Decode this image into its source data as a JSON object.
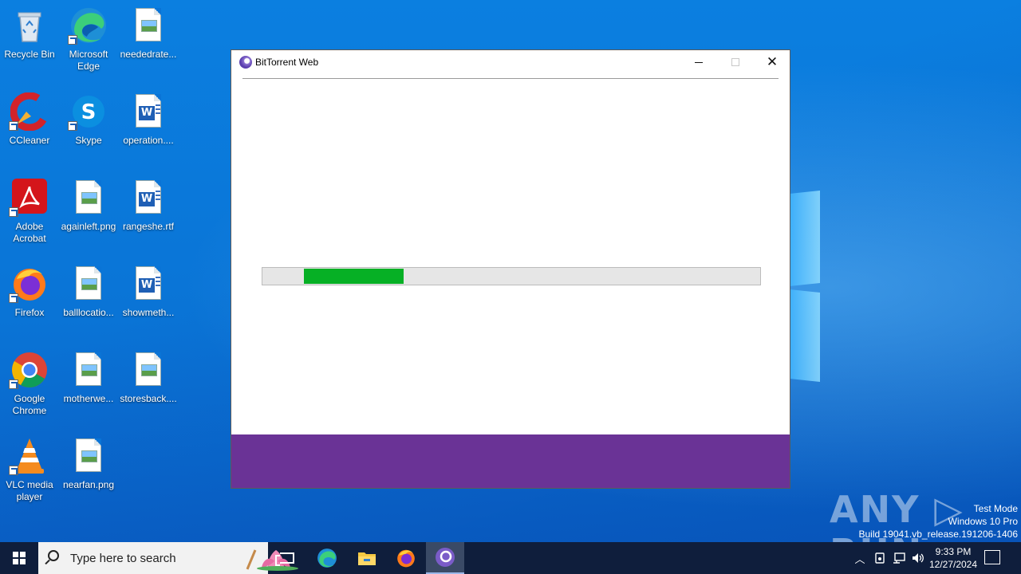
{
  "desktop": {
    "icons": [
      {
        "label": "Recycle Bin",
        "icon": "recycle-bin-icon"
      },
      {
        "label": "Microsoft Edge",
        "icon": "edge-icon"
      },
      {
        "label": "neededrate...",
        "icon": "image-file-icon"
      },
      {
        "label": "CCleaner",
        "icon": "ccleaner-icon"
      },
      {
        "label": "Skype",
        "icon": "skype-icon"
      },
      {
        "label": "operation....",
        "icon": "word-doc-icon"
      },
      {
        "label": "Adobe Acrobat",
        "icon": "acrobat-icon"
      },
      {
        "label": "againleft.png",
        "icon": "image-file-icon"
      },
      {
        "label": "rangeshe.rtf",
        "icon": "word-doc-icon"
      },
      {
        "label": "Firefox",
        "icon": "firefox-icon"
      },
      {
        "label": "balllocatio...",
        "icon": "image-file-icon"
      },
      {
        "label": "showmeth...",
        "icon": "word-doc-icon"
      },
      {
        "label": "Google Chrome",
        "icon": "chrome-icon"
      },
      {
        "label": "motherwe...",
        "icon": "image-file-icon"
      },
      {
        "label": "storesback....",
        "icon": "image-file-icon"
      },
      {
        "label": "VLC media player",
        "icon": "vlc-icon"
      },
      {
        "label": "nearfan.png",
        "icon": "image-file-icon"
      }
    ]
  },
  "window": {
    "title": "BitTorrent Web",
    "progress": 0.2,
    "footer_color": "#6a3396",
    "progress_color": "#06b025"
  },
  "watermark": {
    "brand": "ANY RUN",
    "line1": "Test Mode",
    "line2": "Windows 10 Pro",
    "line3": "Build 19041.vb_release.191206-1406"
  },
  "taskbar": {
    "search_placeholder": "Type here to search",
    "time": "9:33 PM",
    "date": "12/27/2024"
  }
}
